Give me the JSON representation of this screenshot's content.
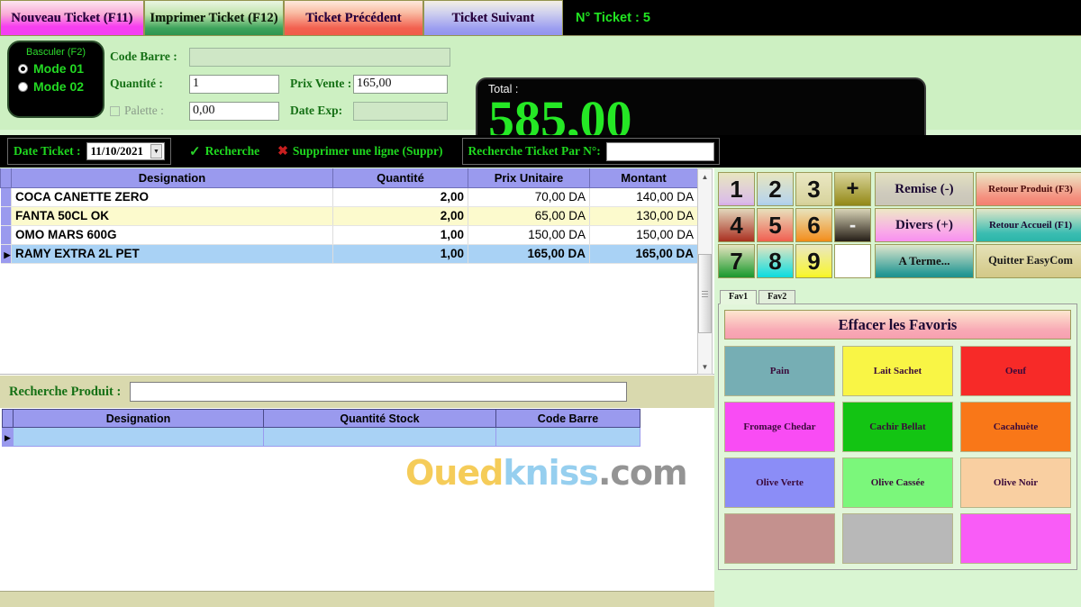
{
  "topbar": {
    "buttons": [
      {
        "label": "Nouveau Ticket (F11)"
      },
      {
        "label": "Imprimer Ticket (F12)"
      },
      {
        "label": "Ticket Précédent"
      },
      {
        "label": "Ticket Suivant"
      }
    ],
    "ticket_number_label": "N° Ticket :  5"
  },
  "entry": {
    "mode_title": "Basculer (F2)",
    "mode1": "Mode 01",
    "mode2": "Mode 02",
    "code_barre_label": "Code Barre :",
    "code_barre_value": "",
    "quantite_label": "Quantité :",
    "quantite_value": "1",
    "prix_vente_label": "Prix Vente :",
    "prix_vente_value": "165,00",
    "palette_label": "Palette :",
    "palette_value": "0,00",
    "date_exp_label": "Date Exp:",
    "date_exp_value": "",
    "total_label": "Total :",
    "total_value": "585,00"
  },
  "toolbar": {
    "date_ticket_label": "Date Ticket :",
    "date_ticket_value": "11/10/2021",
    "recherche_label": "Recherche",
    "supprimer_label": "Supprimer une ligne (Suppr)",
    "recherche_par_n_label": "Recherche Ticket Par N°:",
    "recherche_par_n_value": ""
  },
  "cart": {
    "columns": [
      "Designation",
      "Quantité",
      "Prix Unitaire",
      "Montant"
    ],
    "rows": [
      {
        "designation": "COCA CANETTE ZERO",
        "quantite": "2,00",
        "prix_unitaire": "70,00 DA",
        "montant": "140,00 DA",
        "style": "r-white"
      },
      {
        "designation": "FANTA 50CL OK",
        "quantite": "2,00",
        "prix_unitaire": "65,00 DA",
        "montant": "130,00 DA",
        "style": "r-yellow"
      },
      {
        "designation": "OMO MARS 600G",
        "quantite": "1,00",
        "prix_unitaire": "150,00 DA",
        "montant": "150,00 DA",
        "style": "r-white"
      },
      {
        "designation": "RAMY EXTRA 2L PET",
        "quantite": "1,00",
        "prix_unitaire": "165,00 DA",
        "montant": "165,00 DA",
        "style": "r-sel"
      }
    ]
  },
  "watermark": {
    "part1": "Oued",
    "part2": "kniss",
    "part3": ".com"
  },
  "product_search": {
    "label": "Recherche Produit :",
    "value": "",
    "columns": [
      "Designation",
      "Quantité Stock",
      "Code Barre"
    ],
    "rows": [
      {
        "designation": "",
        "quantite_stock": "",
        "code_barre": ""
      }
    ]
  },
  "keypad": {
    "keys": [
      {
        "label": "1",
        "cls": "k1"
      },
      {
        "label": "2",
        "cls": "k2"
      },
      {
        "label": "3",
        "cls": "k3"
      },
      {
        "label": "+",
        "cls": "kplus"
      },
      {
        "label": "4",
        "cls": "k4"
      },
      {
        "label": "5",
        "cls": "k5"
      },
      {
        "label": "6",
        "cls": "k6"
      },
      {
        "label": "-",
        "cls": "kminus"
      },
      {
        "label": "7",
        "cls": "k7"
      },
      {
        "label": "8",
        "cls": "k8"
      },
      {
        "label": "9",
        "cls": "k9"
      },
      {
        "label": "",
        "cls": "kblank"
      }
    ],
    "actions": [
      {
        "label": "Remise (-)",
        "cls": "s-remise"
      },
      {
        "label": "Retour Produit  (F3)",
        "cls": "s-retprod"
      },
      {
        "label": "Divers (+)",
        "cls": "s-divers"
      },
      {
        "label": "Retour Accueil (F1)",
        "cls": "s-retacc"
      },
      {
        "label": "A Terme...",
        "cls": "s-aterme"
      },
      {
        "label": "Quitter EasyCom",
        "cls": "s-quit"
      }
    ]
  },
  "favorites": {
    "tabs": [
      {
        "label": "Fav1",
        "active": true
      },
      {
        "label": "Fav2",
        "active": false
      }
    ],
    "clear_label": "Effacer les Favoris",
    "items": [
      {
        "label": "Pain",
        "color": "#76aeb4"
      },
      {
        "label": "Lait Sachet",
        "color": "#f9f545"
      },
      {
        "label": "Oeuf",
        "color": "#f72a28"
      },
      {
        "label": "Fromage Chedar",
        "color": "#f94cf4"
      },
      {
        "label": "Cachir Bellat",
        "color": "#13c413"
      },
      {
        "label": "Cacahuète",
        "color": "#f97718"
      },
      {
        "label": "Olive Verte",
        "color": "#8b8df7"
      },
      {
        "label": "Olive Cassée",
        "color": "#7bf77b"
      },
      {
        "label": "Olive Noir",
        "color": "#f9cfa1"
      },
      {
        "label": "",
        "color": "#c4918e"
      },
      {
        "label": "",
        "color": "#b8b8b8"
      },
      {
        "label": "",
        "color": "#f95cf7"
      }
    ]
  }
}
